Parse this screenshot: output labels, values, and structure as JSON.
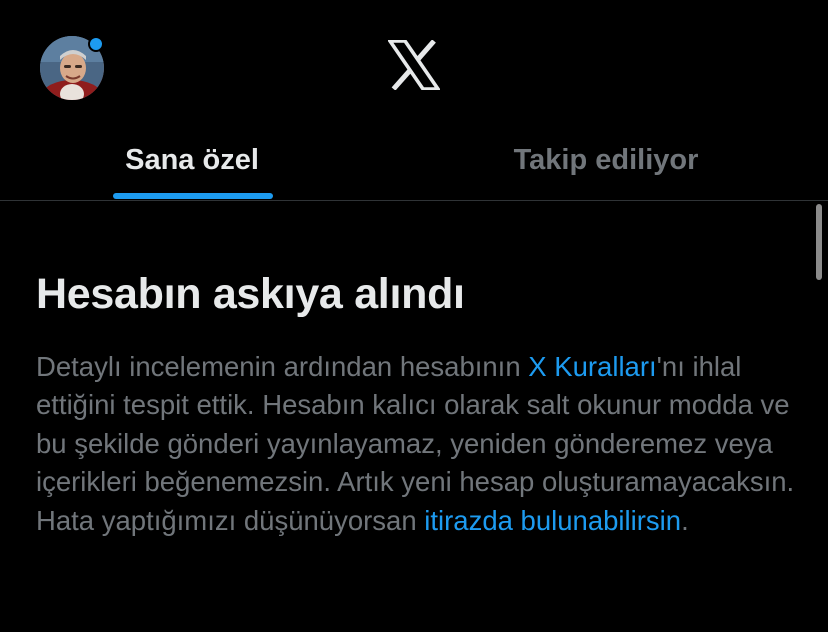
{
  "header": {
    "notification_dot_color": "#1d9bf0",
    "logo_icon": "x-logo-icon",
    "avatar_icon": "profile-avatar"
  },
  "tabs": [
    {
      "label": "Sana özel",
      "active": true
    },
    {
      "label": "Takip ediliyor",
      "active": false
    }
  ],
  "notice": {
    "title": "Hesabın askıya alındı",
    "body_part1": "Detaylı incelemenin ardından hesabının ",
    "rules_link": "X Kuralları",
    "body_part2": "'nı ihlal ettiğini tespit ettik. Hesabın kalıcı olarak salt okunur modda ve bu şekilde gönderi yayınlayamaz, yeniden gönderemez veya içerikleri beğenemezsin. Artık yeni hesap oluşturamayacaksın. Hata yaptığımızı düşünüyorsan ",
    "appeal_link": "itirazda bulunabilirsin",
    "body_part3": "."
  },
  "colors": {
    "background": "#000000",
    "accent": "#1d9bf0",
    "primary_text": "#e7e9ea",
    "secondary_text": "#71767b",
    "divider": "#2f3336"
  }
}
